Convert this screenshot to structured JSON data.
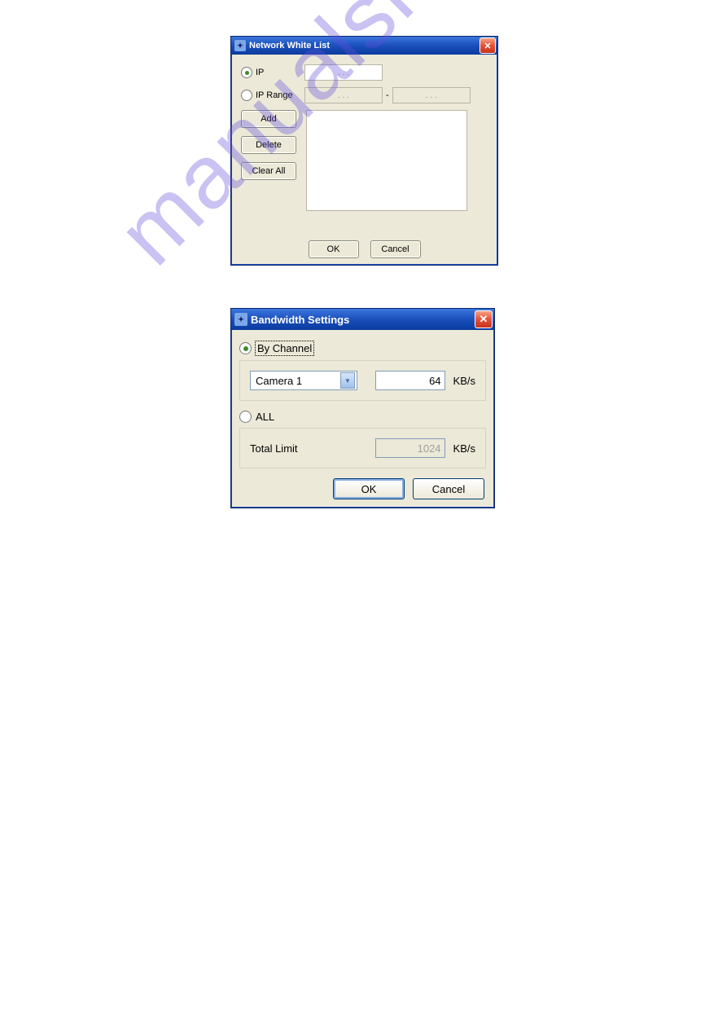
{
  "watermark": "manualshive.com",
  "dialog1": {
    "title": "Network White List",
    "radio_ip": "IP",
    "radio_ip_range": "IP Range",
    "ip_placeholder": ".     .     .",
    "range_sep": "-",
    "btn_add": "Add",
    "btn_delete": "Delete",
    "btn_clear": "Clear All",
    "btn_ok": "OK",
    "btn_cancel": "Cancel"
  },
  "dialog2": {
    "title": "Bandwidth Settings",
    "radio_by_channel": "By Channel",
    "radio_all": "ALL",
    "camera_select": "Camera 1",
    "channel_limit": "64",
    "unit": "KB/s",
    "total_limit_label": "Total Limit",
    "total_limit": "1024",
    "btn_ok": "OK",
    "btn_cancel": "Cancel"
  }
}
